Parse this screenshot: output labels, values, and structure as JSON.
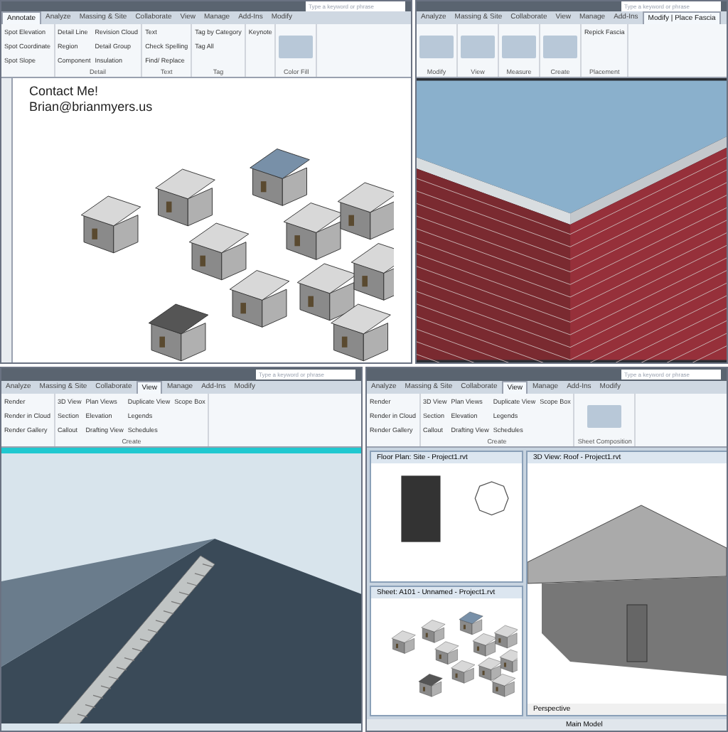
{
  "panels": [
    {
      "kind": "houses",
      "search": {
        "placeholder": "Type a keyword or phrase"
      },
      "tabs": [
        {
          "label": "Annotate",
          "selected": true
        },
        {
          "label": "Analyze",
          "selected": false
        },
        {
          "label": "Massing & Site",
          "selected": false
        },
        {
          "label": "Collaborate",
          "selected": false
        },
        {
          "label": "View",
          "selected": false
        },
        {
          "label": "Manage",
          "selected": false
        },
        {
          "label": "Add-Ins",
          "selected": false
        },
        {
          "label": "Modify",
          "selected": false
        }
      ],
      "groups": [
        {
          "buttons": [
            "Spot Elevation",
            "Spot Coordinate",
            "Spot Slope"
          ]
        },
        {
          "label": "Detail",
          "buttons": [
            "Detail Line",
            "Region",
            "Component",
            "Revision Cloud",
            "Detail Group",
            "Insulation"
          ]
        },
        {
          "label": "Text",
          "buttons": [
            "Text",
            "Check Spelling",
            "Find/ Replace"
          ]
        },
        {
          "label": "Tag",
          "buttons": [
            "Tag by Category",
            "Tag All"
          ]
        },
        {
          "buttons": [
            "Keynote"
          ]
        },
        {
          "label": "Color Fill"
        }
      ],
      "notes": [
        "Contact Me!",
        "Brian@brianmyers.us"
      ]
    },
    {
      "kind": "wall",
      "search": {
        "placeholder": "Type a keyword or phrase"
      },
      "tabs": [
        {
          "label": "Analyze",
          "selected": false
        },
        {
          "label": "Massing & Site",
          "selected": false
        },
        {
          "label": "Collaborate",
          "selected": false
        },
        {
          "label": "View",
          "selected": false
        },
        {
          "label": "Manage",
          "selected": false
        },
        {
          "label": "Add-Ins",
          "selected": false
        },
        {
          "label": "Modify | Place Fascia",
          "selected": true
        }
      ],
      "groups": [
        {
          "label": "Modify"
        },
        {
          "label": "View"
        },
        {
          "label": "Measure"
        },
        {
          "label": "Create"
        },
        {
          "label": "Placement",
          "buttons": [
            "Repick Fascia"
          ]
        }
      ]
    },
    {
      "kind": "roof",
      "search": {
        "placeholder": "Type a keyword or phrase"
      },
      "tabs": [
        {
          "label": "Analyze",
          "selected": false
        },
        {
          "label": "Massing & Site",
          "selected": false
        },
        {
          "label": "Collaborate",
          "selected": false
        },
        {
          "label": "View",
          "selected": true
        },
        {
          "label": "Manage",
          "selected": false
        },
        {
          "label": "Add-Ins",
          "selected": false
        },
        {
          "label": "Modify",
          "selected": false
        }
      ],
      "groups": [
        {
          "buttons": [
            "Render",
            "Render in Cloud",
            "Render Gallery"
          ]
        },
        {
          "label": "Create",
          "buttons": [
            "3D View",
            "Section",
            "Callout",
            "Plan Views",
            "Elevation",
            "Drafting View",
            "Duplicate View",
            "Legends",
            "Schedules",
            "Scope Box"
          ]
        }
      ]
    },
    {
      "kind": "views",
      "search": {
        "placeholder": "Type a keyword or phrase"
      },
      "tabs": [
        {
          "label": "Analyze",
          "selected": false
        },
        {
          "label": "Massing & Site",
          "selected": false
        },
        {
          "label": "Collaborate",
          "selected": false
        },
        {
          "label": "View",
          "selected": true
        },
        {
          "label": "Manage",
          "selected": false
        },
        {
          "label": "Add-Ins",
          "selected": false
        },
        {
          "label": "Modify",
          "selected": false
        }
      ],
      "groups": [
        {
          "buttons": [
            "Render",
            "Render in Cloud",
            "Render Gallery"
          ]
        },
        {
          "label": "Create",
          "buttons": [
            "3D View",
            "Section",
            "Callout",
            "Plan Views",
            "Elevation",
            "Drafting View",
            "Duplicate View",
            "Legends",
            "Schedules",
            "Scope Box"
          ]
        },
        {
          "label": "Sheet Composition"
        }
      ],
      "windows": [
        {
          "kind": "plan",
          "title": "Floor Plan: Site - Project1.rvt"
        },
        {
          "kind": "sheet",
          "title": "Sheet: A101 - Unnamed - Project1.rvt"
        },
        {
          "kind": "view3d",
          "title": "3D View: Roof - Project1.rvt",
          "footer": "Perspective"
        }
      ],
      "status": "Main Model"
    }
  ]
}
